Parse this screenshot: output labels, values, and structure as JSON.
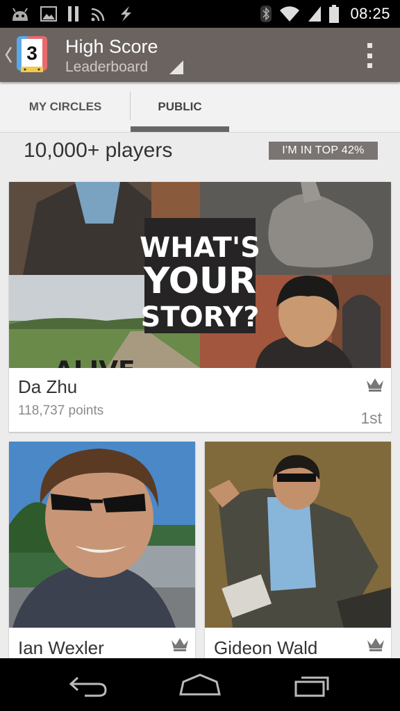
{
  "status_bar": {
    "time": "08:25",
    "icons": [
      "android-icon",
      "image-icon",
      "pause-icon",
      "cast-icon",
      "flash-icon",
      "bluetooth-icon",
      "wifi-icon",
      "signal-icon",
      "battery-icon"
    ]
  },
  "action_bar": {
    "title": "High Score",
    "subtitle": "Leaderboard",
    "app_icon_number": "3",
    "background_color": "#6b6360"
  },
  "tabs": [
    {
      "label": "MY CIRCLES",
      "selected": false
    },
    {
      "label": "PUBLIC",
      "selected": true
    }
  ],
  "summary": {
    "players_count": "10,000+ players",
    "rank_badge": "I'M IN TOP 42%"
  },
  "entries": [
    {
      "name": "Da Zhu",
      "points": "118,737 points",
      "rank": "1st",
      "photo_text": [
        "WHAT'S",
        "YOUR",
        "STORY?"
      ],
      "photo_bottom_text": "ALIVE"
    },
    {
      "name": "Ian Wexler"
    },
    {
      "name": "Gideon Wald"
    }
  ],
  "nav_bar": {
    "buttons": [
      "back-icon",
      "home-icon",
      "recents-icon"
    ]
  }
}
